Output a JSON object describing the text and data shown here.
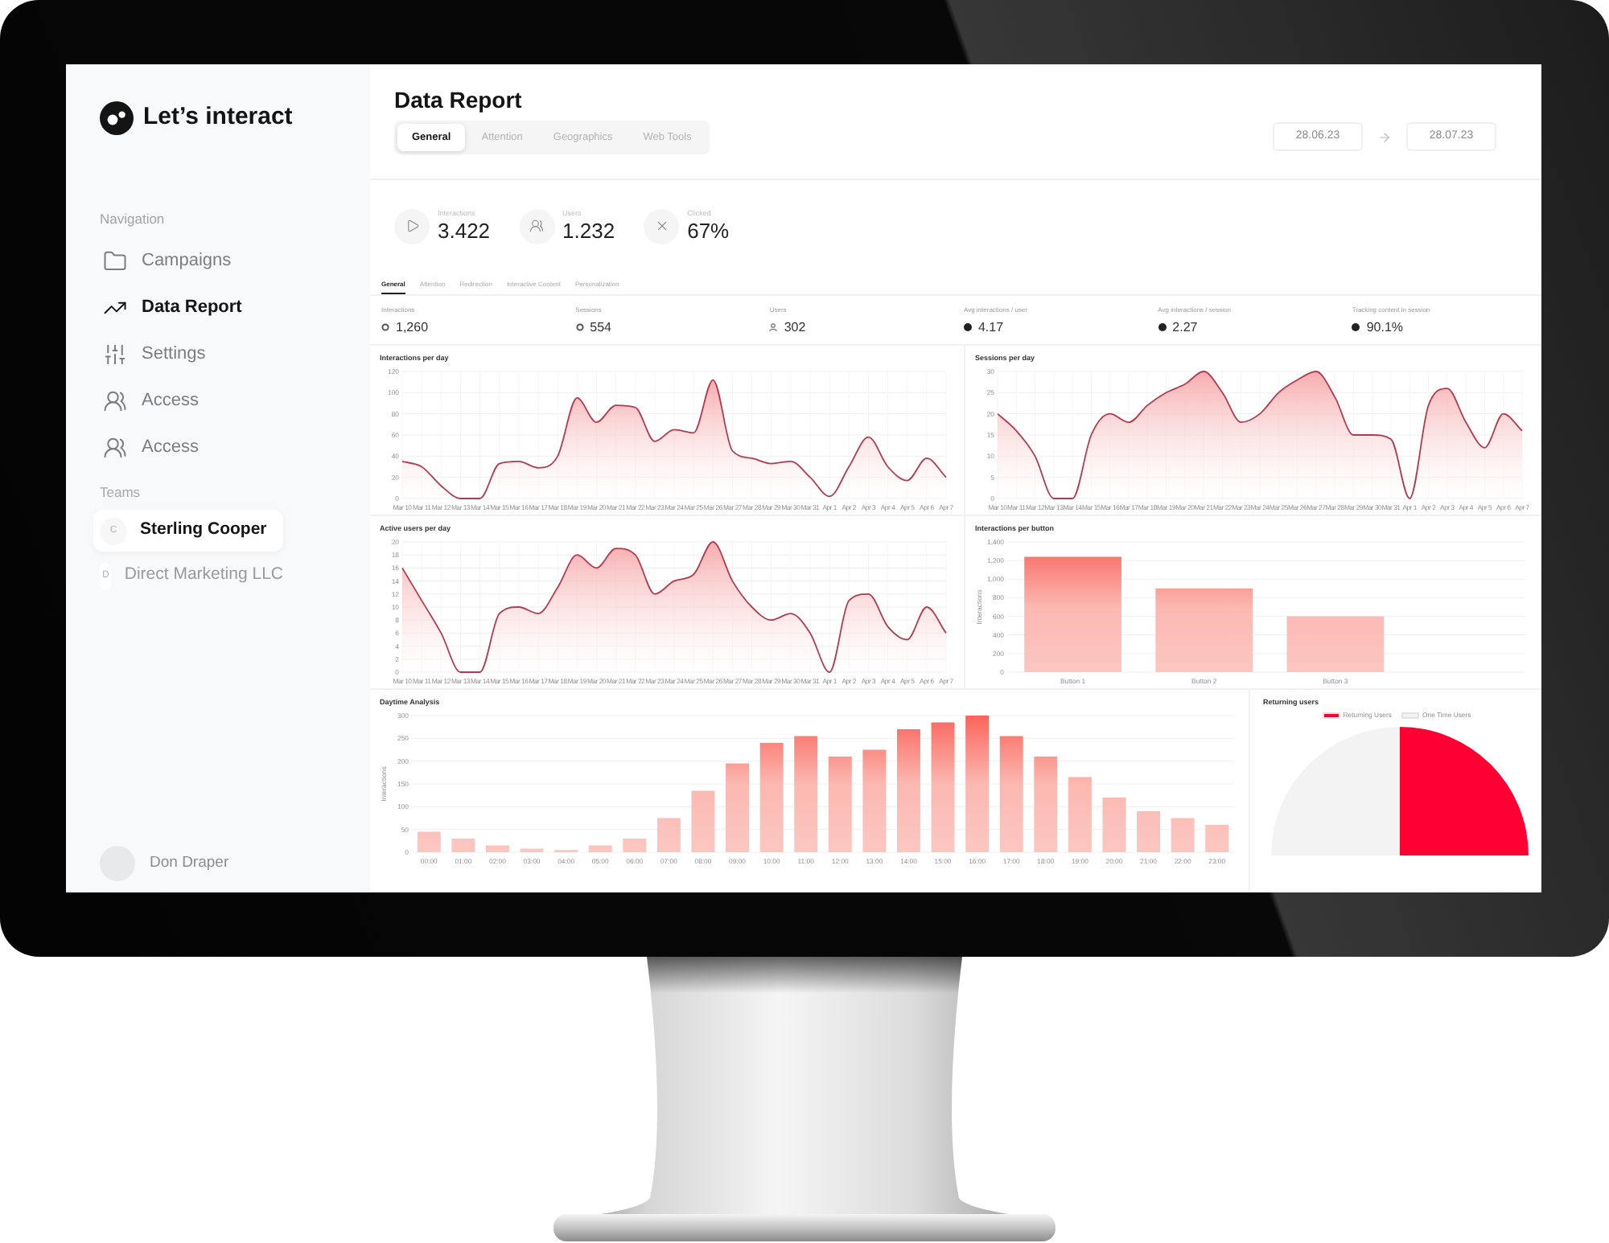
{
  "sidebar": {
    "logo": "Let’s interact",
    "navigation_label": "Navigation",
    "nav_items": [
      {
        "label": "Campaigns",
        "selected": false
      },
      {
        "label": "Data Report",
        "selected": true
      },
      {
        "label": "Settings",
        "selected": false
      },
      {
        "label": "Access",
        "selected": false
      },
      {
        "label": "Access",
        "selected": false
      }
    ],
    "teams_label": "Teams",
    "teams": [
      {
        "initial": "C",
        "name": "Sterling Cooper",
        "selected": true
      },
      {
        "initial": "D",
        "name": "Direct Marketing LLC",
        "selected": false
      }
    ],
    "user": {
      "name": "Don Draper"
    }
  },
  "header": {
    "title": "Data Report",
    "tabs": [
      {
        "label": "General",
        "selected": true
      },
      {
        "label": "Attention",
        "selected": false
      },
      {
        "label": "Geographics",
        "selected": false
      },
      {
        "label": "Web Tools",
        "selected": false
      }
    ],
    "date_range": {
      "start": "28.06.23",
      "end": "28.07.23"
    }
  },
  "stats": [
    {
      "label": "Interactions",
      "value": "3.422"
    },
    {
      "label": "Users",
      "value": "1.232"
    },
    {
      "label": "Clicked",
      "value": "67%"
    }
  ],
  "sub_tabs": [
    {
      "label": "General",
      "selected": true
    },
    {
      "label": "Attention",
      "selected": false
    },
    {
      "label": "Redirection",
      "selected": false
    },
    {
      "label": "Interactive Content",
      "selected": false
    },
    {
      "label": "Personalization",
      "selected": false
    }
  ],
  "metrics": [
    {
      "label": "Interactions",
      "value": "1,260"
    },
    {
      "label": "Sessions",
      "value": "554"
    },
    {
      "label": "Users",
      "value": "302"
    },
    {
      "label": "Avg interactions / user",
      "value": "4.17"
    },
    {
      "label": "Avg interactions / session",
      "value": "2.27"
    },
    {
      "label": "Tracking content in session",
      "value": "90.1%"
    }
  ],
  "charts": [
    {
      "chart_data": {
        "type": "area",
        "title": "Interactions per day",
        "categories": [
          "Mar 10",
          "Mar 11",
          "Mar 12",
          "Mar 13",
          "Mar 14",
          "Mar 15",
          "Mar 16",
          "Mar 17",
          "Mar 18",
          "Mar 19",
          "Mar 20",
          "Mar 21",
          "Mar 22",
          "Mar 23",
          "Mar 24",
          "Mar 25",
          "Mar 26",
          "Mar 27",
          "Mar 28",
          "Mar 29",
          "Mar 30",
          "Mar 31",
          "Apr 1",
          "Apr 2",
          "Apr 3",
          "Apr 4",
          "Apr 5",
          "Apr 6",
          "Apr 7"
        ],
        "values": [
          35,
          30,
          12,
          0,
          0,
          33,
          35,
          29,
          40,
          95,
          72,
          88,
          86,
          54,
          65,
          62,
          112,
          45,
          38,
          33,
          35,
          20,
          2,
          30,
          58,
          30,
          17,
          38,
          20
        ],
        "ylim": [
          0,
          120
        ],
        "yticks": [
          0,
          20,
          40,
          60,
          80,
          100,
          120
        ],
        "grid": true
      }
    },
    {
      "chart_data": {
        "type": "area",
        "title": "Sessions per day",
        "categories": [
          "Mar 10",
          "Mar 11",
          "Mar 12",
          "Mar 13",
          "Mar 14",
          "Mar 15",
          "Mar 16",
          "Mar 17",
          "Mar 18",
          "Mar 19",
          "Mar 20",
          "Mar 21",
          "Mar 22",
          "Mar 23",
          "Mar 24",
          "Mar 25",
          "Mar 26",
          "Mar 27",
          "Mar 28",
          "Mar 29",
          "Mar 30",
          "Mar 31",
          "Apr 1",
          "Apr 2",
          "Apr 3",
          "Apr 4",
          "Apr 5",
          "Apr 6",
          "Apr 7"
        ],
        "values": [
          20,
          16,
          10,
          0,
          0,
          15,
          20,
          18,
          22,
          25,
          27,
          30,
          25,
          18,
          20,
          25,
          28,
          30,
          24,
          15,
          15,
          14,
          0,
          22,
          26,
          18,
          12,
          20,
          16
        ],
        "ylim": [
          0,
          30
        ],
        "yticks": [
          0,
          5,
          10,
          15,
          20,
          25,
          30
        ],
        "grid": true
      }
    },
    {
      "chart_data": {
        "type": "area",
        "title": "Active users per day",
        "categories": [
          "Mar 10",
          "Mar 11",
          "Mar 12",
          "Mar 13",
          "Mar 14",
          "Mar 15",
          "Mar 16",
          "Mar 17",
          "Mar 18",
          "Mar 19",
          "Mar 20",
          "Mar 21",
          "Mar 22",
          "Mar 23",
          "Mar 24",
          "Mar 25",
          "Mar 26",
          "Mar 27",
          "Mar 28",
          "Mar 29",
          "Mar 30",
          "Mar 31",
          "Apr 1",
          "Apr 2",
          "Apr 3",
          "Apr 4",
          "Apr 5",
          "Apr 6",
          "Apr 7"
        ],
        "values": [
          16,
          11,
          6,
          0,
          0,
          9,
          10,
          9,
          13,
          18,
          16,
          19,
          18,
          12,
          14,
          15,
          20,
          14,
          10,
          8,
          9,
          6,
          0,
          11,
          12,
          7,
          5,
          10,
          6
        ],
        "ylim": [
          0,
          20
        ],
        "yticks": [
          0,
          2,
          4,
          6,
          8,
          10,
          12,
          14,
          16,
          18,
          20
        ],
        "grid": true
      }
    },
    {
      "chart_data": {
        "type": "bar",
        "title": "Interactions per button",
        "ylabel": "Interactions",
        "categories": [
          "Button 1",
          "Button 2",
          "Button 3"
        ],
        "values": [
          1240,
          900,
          600
        ],
        "ylim": [
          0,
          1400
        ],
        "yticks": [
          0,
          200,
          400,
          600,
          800,
          {
            "value": 1000,
            "label": "1,000"
          },
          {
            "value": 1200,
            "label": "1,200"
          },
          {
            "value": 1400,
            "label": "1,400"
          }
        ],
        "grid": true
      }
    }
  ],
  "daytime_analysis": {
    "chart_data": {
      "type": "bar",
      "title": "Daytime Analysis",
      "ylabel": "Interactions",
      "categories": [
        "00:00",
        "01:00",
        "02:00",
        "03:00",
        "04:00",
        "05:00",
        "06:00",
        "07:00",
        "08:00",
        "09:00",
        "10:00",
        "11:00",
        "12:00",
        "13:00",
        "14:00",
        "15:00",
        "16:00",
        "17:00",
        "18:00",
        "19:00",
        "20:00",
        "21:00",
        "22:00",
        "23:00"
      ],
      "values": [
        45,
        30,
        15,
        8,
        5,
        15,
        30,
        75,
        135,
        195,
        240,
        255,
        210,
        225,
        270,
        285,
        300,
        255,
        210,
        165,
        120,
        90,
        75,
        60
      ],
      "ylim": [
        0,
        300
      ],
      "yticks": [
        0,
        50,
        100,
        150,
        200,
        250,
        300
      ],
      "grid": true
    }
  },
  "returning_users": {
    "title": "Returning users",
    "legend": [
      {
        "label": "Returning Users",
        "color": "#fe0032"
      },
      {
        "label": "One Time Users",
        "color": "#f3f3f3"
      }
    ]
  }
}
